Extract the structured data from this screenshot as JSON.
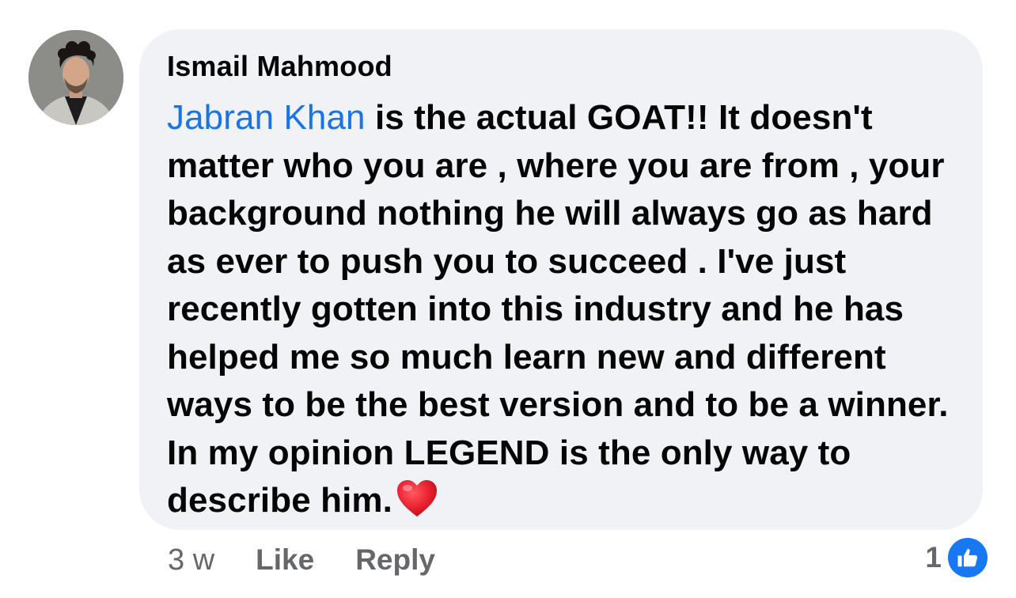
{
  "comment": {
    "author": "Ismail Mahmood",
    "mention": "Jabran Khan",
    "text": " is the actual GOAT!! It doesn't matter who you are , where you are from , your background nothing he will always go as hard as ever to push you to succeed . I've just recently gotten into this industry and he has helped me so much learn new and different ways to be the best version and to be a winner. In my opinion LEGEND is the only way to describe him.",
    "emoji": "red-heart-icon"
  },
  "actions": {
    "time": "3 w",
    "like_label": "Like",
    "reply_label": "Reply"
  },
  "reactions": {
    "count": "1",
    "type": "like-icon"
  },
  "colors": {
    "bubble": "#f0f2f5",
    "mention": "#1b74e4",
    "text": "#050505",
    "meta": "#65676b",
    "like_badge": "#1877f2",
    "heart": "#e8202e"
  }
}
